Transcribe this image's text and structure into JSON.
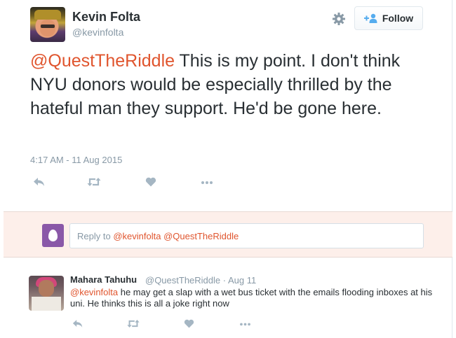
{
  "tweet": {
    "author_name": "Kevin Folta",
    "author_handle": "@kevinfolta",
    "follow_label": "Follow",
    "mention": "@QuestTheRiddle",
    "body": " This is my point. I don't think NYU donors would be especially thrilled by the hateful man they support. He'd be gone here.",
    "timestamp": "4:17 AM - 11 Aug 2015",
    "actions": [
      "reply-icon",
      "retweet-icon",
      "like-icon",
      "more-icon"
    ]
  },
  "reply_box": {
    "prefix": "Reply to ",
    "mention_1": "@kevinfolta",
    "mention_2": "@QuestTheRiddle"
  },
  "reply_tweet": {
    "author_name": "Mahara Tahuhu",
    "meta": "@QuestTheRiddle · Aug 11",
    "mention": "@kevinfolta",
    "body": " he may get a slap with a wet bus ticket with the emails flooding inboxes at his uni. He thinks this is all a joke right now",
    "actions": [
      "reply-icon",
      "retweet-icon",
      "like-icon",
      "more-icon"
    ]
  },
  "colors": {
    "mention": "#e0552e",
    "muted": "#8899a6",
    "reply_background": "#fdefea",
    "egg_avatar": "#8a58a8",
    "follow_icon": "#55acee"
  }
}
